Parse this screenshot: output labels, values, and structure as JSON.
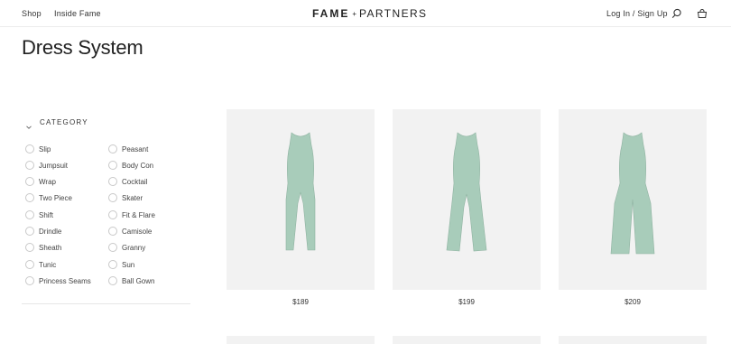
{
  "header": {
    "shop": "Shop",
    "inside": "Inside Fame",
    "logo_brand": "FAME",
    "logo_sep": "+",
    "logo_partners": "PARTNERS",
    "login": "Log In / Sign Up",
    "search_icon": "search-icon",
    "bag_icon": "bag-icon"
  },
  "page": {
    "title": "Dress System"
  },
  "filter": {
    "category_label": "CATEGORY",
    "col1": [
      "Slip",
      "Jumpsuit",
      "Wrap",
      "Two Piece",
      "Shift",
      "Drindle",
      "Sheath",
      "Tunic",
      "Princess Seams"
    ],
    "col2": [
      "Peasant",
      "Body Con",
      "Cocktail",
      "Skater",
      "Fit & Flare",
      "Camisole",
      "Granny",
      "Sun",
      "Ball Gown"
    ]
  },
  "products": [
    {
      "price": "$189",
      "color": "#a8ccba"
    },
    {
      "price": "$199",
      "color": "#a8ccba"
    },
    {
      "price": "$209",
      "color": "#a8ccba"
    }
  ]
}
